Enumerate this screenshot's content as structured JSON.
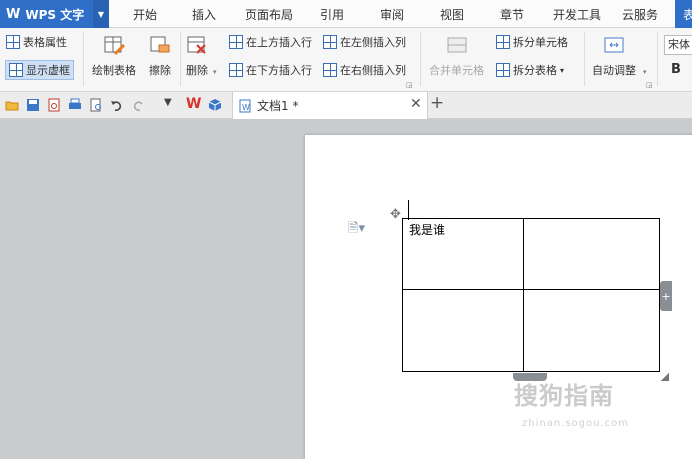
{
  "app": {
    "logo": "W",
    "name": "WPS 文字"
  },
  "menu_tabs": [
    "开始",
    "插入",
    "页面布局",
    "引用",
    "审阅",
    "视图",
    "章节",
    "开发工具",
    "云服务",
    "表"
  ],
  "ribbon": {
    "table_properties": "表格属性",
    "show_gridlines": "显示虚框",
    "draw_table": "绘制表格",
    "eraser": "擦除",
    "delete": "删除",
    "insert_above": "在上方插入行",
    "insert_below": "在下方插入行",
    "insert_left": "在左侧插入列",
    "insert_right": "在右侧插入列",
    "merge_cells": "合并单元格",
    "split_cells": "拆分单元格",
    "split_table": "拆分表格",
    "auto_fit": "自动调整",
    "font_name": "宋体",
    "bold": "B"
  },
  "document_tab": {
    "title": "文档1 *"
  },
  "document": {
    "cell_text": "我是谁"
  },
  "watermark": {
    "main": "搜狗指南",
    "sub": "zhinan.sogou.com"
  },
  "colors": {
    "accent": "#2f6fc8",
    "canvas": "#c9cbcf"
  }
}
